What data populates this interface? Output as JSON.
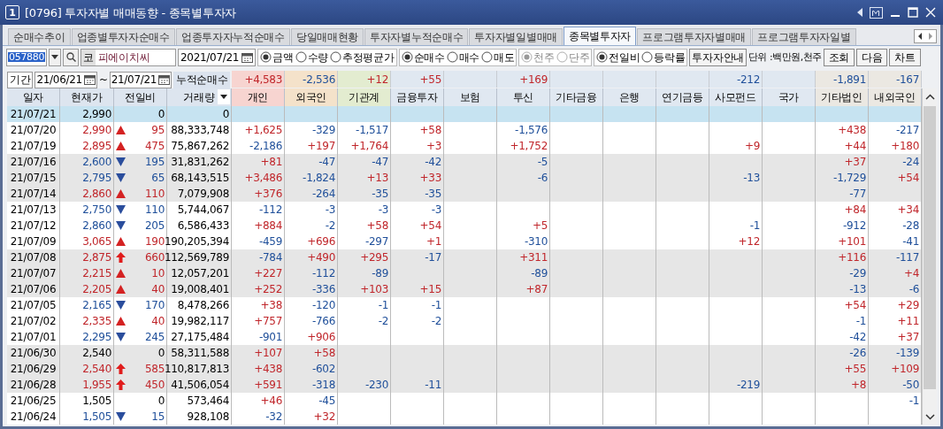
{
  "window": {
    "badge": "1",
    "title": "[0796] 투자자별 매매동향 - 종목별투자자"
  },
  "tabs": [
    {
      "label": "순매수추이",
      "selected": false
    },
    {
      "label": "업종별투자자순매수",
      "selected": false
    },
    {
      "label": "업종투자자누적순매수",
      "selected": false
    },
    {
      "label": "당일매매현황",
      "selected": false
    },
    {
      "label": "투자자별누적순매수",
      "selected": false
    },
    {
      "label": "투자자별일별매매",
      "selected": false
    },
    {
      "label": "종목별투자자",
      "selected": true
    },
    {
      "label": "프로그램투자자별매매",
      "selected": false
    },
    {
      "label": "프로그램투자자일별",
      "selected": false
    }
  ],
  "toolbar": {
    "code": "057880",
    "market_badge": "코",
    "stock_name": "피에이치씨",
    "date": "2021/07/21",
    "radio_groups": [
      {
        "disabled": false,
        "options": [
          {
            "label": "금액",
            "selected": true
          },
          {
            "label": "수량",
            "selected": false
          },
          {
            "label": "추정평균가",
            "selected": false
          }
        ]
      },
      {
        "disabled": false,
        "options": [
          {
            "label": "순매수",
            "selected": true
          },
          {
            "label": "매수",
            "selected": false
          },
          {
            "label": "매도",
            "selected": false
          }
        ]
      },
      {
        "disabled": true,
        "options": [
          {
            "label": "천주",
            "selected": true
          },
          {
            "label": "단주",
            "selected": false
          }
        ]
      },
      {
        "disabled": false,
        "options": [
          {
            "label": "전일비",
            "selected": true
          },
          {
            "label": "등락률",
            "selected": false
          }
        ]
      }
    ],
    "guide_button": "투자자안내",
    "unit": "단위 :백만원,천주",
    "buttons": [
      "조회",
      "다음",
      "차트"
    ]
  },
  "period": {
    "label": "기간",
    "from": "21/06/21",
    "separator": "~",
    "to": "21/07/21",
    "summary_label": "누적순매수"
  },
  "table": {
    "columns": [
      "일자",
      "현재가",
      "전일비",
      "거래량"
    ],
    "investor_columns": [
      {
        "label": "개인",
        "color": "#f7d4d0"
      },
      {
        "label": "외국인",
        "color": "#f4e2ca"
      },
      {
        "label": "기관계",
        "color": "#e3ecd0"
      },
      {
        "label": "금융투자",
        "color": "#e0e8f1"
      },
      {
        "label": "보험",
        "color": "#e0e8f1"
      },
      {
        "label": "투신",
        "color": "#e0e8f1"
      },
      {
        "label": "기타금융",
        "color": "#e0e8f1"
      },
      {
        "label": "은행",
        "color": "#e0e8f1"
      },
      {
        "label": "연기금등",
        "color": "#e0e8f1"
      },
      {
        "label": "사모펀드",
        "color": "#e0e8f1"
      },
      {
        "label": "국가",
        "color": "#e0e8f1"
      },
      {
        "label": "기타법인",
        "color": "#ebe8e2"
      },
      {
        "label": "내외국인",
        "color": "#ebe8e2"
      }
    ],
    "summary": [
      {
        "value": "+4,583"
      },
      {
        "value": "-2,536"
      },
      {
        "value": "+12"
      },
      {
        "value": "+55"
      },
      {
        "blank": true
      },
      {
        "value": "+169"
      },
      {
        "blank": true
      },
      {
        "blank": true
      },
      {
        "blank": true
      },
      {
        "value": "-212"
      },
      {
        "blank": true
      },
      {
        "value": "-1,891"
      },
      {
        "value": "-167"
      }
    ],
    "rows": [
      {
        "date": "21/07/21",
        "price": "2,990",
        "kind": "flat",
        "change": "0",
        "volume": "0",
        "selected": true,
        "values": [
          {
            "blank": true
          },
          {
            "blank": true
          },
          {
            "blank": true
          },
          {
            "blank": true
          },
          {
            "blank": true
          },
          {
            "blank": true
          },
          {
            "blank": true
          },
          {
            "blank": true
          },
          {
            "blank": true
          },
          {
            "blank": true
          },
          {
            "blank": true
          },
          {
            "blank": true
          },
          {
            "blank": true
          }
        ]
      },
      {
        "date": "21/07/20",
        "price": "2,990",
        "kind": "up",
        "change": "95",
        "volume": "88,333,748",
        "selected": false,
        "shaded": false,
        "values": [
          {
            "value": "+1,625"
          },
          {
            "value": "-329"
          },
          {
            "value": "-1,517"
          },
          {
            "value": "+58"
          },
          {
            "blank": true
          },
          {
            "value": "-1,576"
          },
          {
            "blank": true
          },
          {
            "blank": true
          },
          {
            "blank": true
          },
          {
            "blank": true
          },
          {
            "blank": true
          },
          {
            "value": "+438"
          },
          {
            "value": "-217"
          }
        ]
      },
      {
        "date": "21/07/19",
        "price": "2,895",
        "kind": "up",
        "change": "475",
        "volume": "75,867,262",
        "selected": false,
        "shaded": false,
        "values": [
          {
            "value": "-2,186"
          },
          {
            "value": "+197"
          },
          {
            "value": "+1,764"
          },
          {
            "value": "+3"
          },
          {
            "blank": true
          },
          {
            "value": "+1,752"
          },
          {
            "blank": true
          },
          {
            "blank": true
          },
          {
            "blank": true
          },
          {
            "value": "+9"
          },
          {
            "blank": true
          },
          {
            "value": "+44"
          },
          {
            "value": "+180"
          }
        ]
      },
      {
        "date": "21/07/16",
        "price": "2,600",
        "kind": "down",
        "change": "195",
        "volume": "31,831,262",
        "selected": false,
        "shaded": true,
        "values": [
          {
            "value": "+81"
          },
          {
            "value": "-47"
          },
          {
            "value": "-47"
          },
          {
            "value": "-42"
          },
          {
            "blank": true
          },
          {
            "value": "-5"
          },
          {
            "blank": true
          },
          {
            "blank": true
          },
          {
            "blank": true
          },
          {
            "blank": true
          },
          {
            "blank": true
          },
          {
            "value": "+37"
          },
          {
            "value": "-24"
          }
        ]
      },
      {
        "date": "21/07/15",
        "price": "2,795",
        "kind": "down",
        "change": "65",
        "volume": "68,143,515",
        "selected": false,
        "shaded": true,
        "values": [
          {
            "value": "+3,486"
          },
          {
            "value": "-1,824"
          },
          {
            "value": "+13"
          },
          {
            "value": "+33"
          },
          {
            "blank": true
          },
          {
            "value": "-6"
          },
          {
            "blank": true
          },
          {
            "blank": true
          },
          {
            "blank": true
          },
          {
            "value": "-13"
          },
          {
            "blank": true
          },
          {
            "value": "-1,729"
          },
          {
            "value": "+54"
          }
        ]
      },
      {
        "date": "21/07/14",
        "price": "2,860",
        "kind": "up",
        "change": "110",
        "volume": "7,079,908",
        "selected": false,
        "shaded": true,
        "values": [
          {
            "value": "+376"
          },
          {
            "value": "-264"
          },
          {
            "value": "-35"
          },
          {
            "value": "-35"
          },
          {
            "blank": true
          },
          {
            "blank": true
          },
          {
            "blank": true
          },
          {
            "blank": true
          },
          {
            "blank": true
          },
          {
            "blank": true
          },
          {
            "blank": true
          },
          {
            "value": "-77"
          },
          {
            "blank": true
          }
        ]
      },
      {
        "date": "21/07/13",
        "price": "2,750",
        "kind": "down",
        "change": "110",
        "volume": "5,744,067",
        "selected": false,
        "shaded": false,
        "values": [
          {
            "value": "-112"
          },
          {
            "value": "-3"
          },
          {
            "value": "-3"
          },
          {
            "value": "-3"
          },
          {
            "blank": true
          },
          {
            "blank": true
          },
          {
            "blank": true
          },
          {
            "blank": true
          },
          {
            "blank": true
          },
          {
            "blank": true
          },
          {
            "blank": true
          },
          {
            "value": "+84"
          },
          {
            "value": "+34"
          }
        ]
      },
      {
        "date": "21/07/12",
        "price": "2,860",
        "kind": "down",
        "change": "205",
        "volume": "6,586,433",
        "selected": false,
        "shaded": false,
        "values": [
          {
            "value": "+884"
          },
          {
            "value": "-2"
          },
          {
            "value": "+58"
          },
          {
            "value": "+54"
          },
          {
            "blank": true
          },
          {
            "value": "+5"
          },
          {
            "blank": true
          },
          {
            "blank": true
          },
          {
            "blank": true
          },
          {
            "value": "-1"
          },
          {
            "blank": true
          },
          {
            "value": "-912"
          },
          {
            "value": "-28"
          }
        ]
      },
      {
        "date": "21/07/09",
        "price": "3,065",
        "kind": "up",
        "change": "190",
        "volume": "190,205,394",
        "selected": false,
        "shaded": false,
        "values": [
          {
            "value": "-459"
          },
          {
            "value": "+696"
          },
          {
            "value": "-297"
          },
          {
            "value": "+1"
          },
          {
            "blank": true
          },
          {
            "value": "-310"
          },
          {
            "blank": true
          },
          {
            "blank": true
          },
          {
            "blank": true
          },
          {
            "value": "+12"
          },
          {
            "blank": true
          },
          {
            "value": "+101"
          },
          {
            "value": "-41"
          }
        ]
      },
      {
        "date": "21/07/08",
        "price": "2,875",
        "kind": "limit_up",
        "change": "660",
        "volume": "112,569,789",
        "selected": false,
        "shaded": true,
        "values": [
          {
            "value": "-784"
          },
          {
            "value": "+490"
          },
          {
            "value": "+295"
          },
          {
            "value": "-17"
          },
          {
            "blank": true
          },
          {
            "value": "+311"
          },
          {
            "blank": true
          },
          {
            "blank": true
          },
          {
            "blank": true
          },
          {
            "blank": true
          },
          {
            "blank": true
          },
          {
            "value": "+116"
          },
          {
            "value": "-117"
          }
        ]
      },
      {
        "date": "21/07/07",
        "price": "2,215",
        "kind": "up",
        "change": "10",
        "volume": "12,057,201",
        "selected": false,
        "shaded": true,
        "values": [
          {
            "value": "+227"
          },
          {
            "value": "-112"
          },
          {
            "value": "-89"
          },
          {
            "blank": true
          },
          {
            "blank": true
          },
          {
            "value": "-89"
          },
          {
            "blank": true
          },
          {
            "blank": true
          },
          {
            "blank": true
          },
          {
            "blank": true
          },
          {
            "blank": true
          },
          {
            "value": "-29"
          },
          {
            "value": "+4"
          }
        ]
      },
      {
        "date": "21/07/06",
        "price": "2,205",
        "kind": "up",
        "change": "40",
        "volume": "19,008,401",
        "selected": false,
        "shaded": true,
        "values": [
          {
            "value": "+252"
          },
          {
            "value": "-336"
          },
          {
            "value": "+103"
          },
          {
            "value": "+15"
          },
          {
            "blank": true
          },
          {
            "value": "+87"
          },
          {
            "blank": true
          },
          {
            "blank": true
          },
          {
            "blank": true
          },
          {
            "blank": true
          },
          {
            "blank": true
          },
          {
            "value": "-13"
          },
          {
            "value": "-6"
          }
        ]
      },
      {
        "date": "21/07/05",
        "price": "2,165",
        "kind": "down",
        "change": "170",
        "volume": "8,478,266",
        "selected": false,
        "shaded": false,
        "values": [
          {
            "value": "+38"
          },
          {
            "value": "-120"
          },
          {
            "value": "-1"
          },
          {
            "value": "-1"
          },
          {
            "blank": true
          },
          {
            "blank": true
          },
          {
            "blank": true
          },
          {
            "blank": true
          },
          {
            "blank": true
          },
          {
            "blank": true
          },
          {
            "blank": true
          },
          {
            "value": "+54"
          },
          {
            "value": "+29"
          }
        ]
      },
      {
        "date": "21/07/02",
        "price": "2,335",
        "kind": "up",
        "change": "40",
        "volume": "19,982,117",
        "selected": false,
        "shaded": false,
        "values": [
          {
            "value": "+757"
          },
          {
            "value": "-766"
          },
          {
            "value": "-2"
          },
          {
            "value": "-2"
          },
          {
            "blank": true
          },
          {
            "blank": true
          },
          {
            "blank": true
          },
          {
            "blank": true
          },
          {
            "blank": true
          },
          {
            "blank": true
          },
          {
            "blank": true
          },
          {
            "value": "-1"
          },
          {
            "value": "+11"
          }
        ]
      },
      {
        "date": "21/07/01",
        "price": "2,295",
        "kind": "down",
        "change": "245",
        "volume": "27,175,484",
        "selected": false,
        "shaded": false,
        "values": [
          {
            "value": "-901"
          },
          {
            "value": "+906"
          },
          {
            "blank": true
          },
          {
            "blank": true
          },
          {
            "blank": true
          },
          {
            "blank": true
          },
          {
            "blank": true
          },
          {
            "blank": true
          },
          {
            "blank": true
          },
          {
            "blank": true
          },
          {
            "blank": true
          },
          {
            "value": "-42"
          },
          {
            "value": "+37"
          }
        ]
      },
      {
        "date": "21/06/30",
        "price": "2,540",
        "kind": "flat",
        "change": "0",
        "volume": "58,311,588",
        "selected": false,
        "shaded": true,
        "values": [
          {
            "value": "+107"
          },
          {
            "value": "+58"
          },
          {
            "blank": true
          },
          {
            "blank": true
          },
          {
            "blank": true
          },
          {
            "blank": true
          },
          {
            "blank": true
          },
          {
            "blank": true
          },
          {
            "blank": true
          },
          {
            "blank": true
          },
          {
            "blank": true
          },
          {
            "value": "-26"
          },
          {
            "value": "-139"
          }
        ]
      },
      {
        "date": "21/06/29",
        "price": "2,540",
        "kind": "limit_up",
        "change": "585",
        "volume": "110,817,813",
        "selected": false,
        "shaded": true,
        "values": [
          {
            "value": "+438"
          },
          {
            "value": "-602"
          },
          {
            "blank": true
          },
          {
            "blank": true
          },
          {
            "blank": true
          },
          {
            "blank": true
          },
          {
            "blank": true
          },
          {
            "blank": true
          },
          {
            "blank": true
          },
          {
            "blank": true
          },
          {
            "blank": true
          },
          {
            "value": "+55"
          },
          {
            "value": "+109"
          }
        ]
      },
      {
        "date": "21/06/28",
        "price": "1,955",
        "kind": "limit_up",
        "change": "450",
        "volume": "41,506,054",
        "selected": false,
        "shaded": true,
        "values": [
          {
            "value": "+591"
          },
          {
            "value": "-318"
          },
          {
            "value": "-230"
          },
          {
            "value": "-11"
          },
          {
            "blank": true
          },
          {
            "blank": true
          },
          {
            "blank": true
          },
          {
            "blank": true
          },
          {
            "blank": true
          },
          {
            "value": "-219"
          },
          {
            "blank": true
          },
          {
            "value": "+8"
          },
          {
            "value": "-50"
          }
        ]
      },
      {
        "date": "21/06/25",
        "price": "1,505",
        "kind": "flat",
        "change": "0",
        "volume": "573,464",
        "selected": false,
        "shaded": false,
        "values": [
          {
            "value": "+46"
          },
          {
            "value": "-45"
          },
          {
            "blank": true
          },
          {
            "blank": true
          },
          {
            "blank": true
          },
          {
            "blank": true
          },
          {
            "blank": true
          },
          {
            "blank": true
          },
          {
            "blank": true
          },
          {
            "blank": true
          },
          {
            "blank": true
          },
          {
            "blank": true
          },
          {
            "value": "-1"
          }
        ]
      },
      {
        "date": "21/06/24",
        "price": "1,505",
        "kind": "down",
        "change": "15",
        "volume": "928,108",
        "selected": false,
        "shaded": false,
        "values": [
          {
            "value": "-32"
          },
          {
            "value": "+32"
          },
          {
            "blank": true
          },
          {
            "blank": true
          },
          {
            "blank": true
          },
          {
            "blank": true
          },
          {
            "blank": true
          },
          {
            "blank": true
          },
          {
            "blank": true
          },
          {
            "blank": true
          },
          {
            "blank": true
          },
          {
            "blank": true
          },
          {
            "blank": true
          }
        ]
      }
    ]
  }
}
